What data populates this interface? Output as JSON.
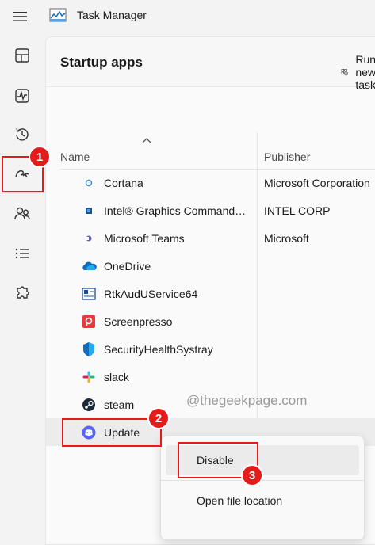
{
  "app": {
    "title": "Task Manager"
  },
  "page": {
    "title": "Startup apps",
    "run_label": "Run new task"
  },
  "columns": {
    "name": "Name",
    "publisher": "Publisher"
  },
  "rows": [
    {
      "name": "Cortana",
      "publisher": "Microsoft Corporation",
      "icon": "cortana-icon"
    },
    {
      "name": "Intel® Graphics Command…",
      "publisher": "INTEL CORP",
      "icon": "intel-graphics-icon"
    },
    {
      "name": "Microsoft Teams",
      "publisher": "Microsoft",
      "icon": "teams-icon"
    },
    {
      "name": "OneDrive",
      "publisher": "",
      "icon": "onedrive-icon"
    },
    {
      "name": "RtkAudUService64",
      "publisher": "",
      "icon": "realtek-icon"
    },
    {
      "name": "Screenpresso",
      "publisher": "",
      "icon": "screenpresso-icon"
    },
    {
      "name": "SecurityHealthSystray",
      "publisher": "",
      "icon": "security-shield-icon"
    },
    {
      "name": "slack",
      "publisher": "",
      "icon": "slack-icon"
    },
    {
      "name": "steam",
      "publisher": "",
      "icon": "steam-icon"
    },
    {
      "name": "Update",
      "publisher": "",
      "icon": "discord-icon"
    }
  ],
  "context_menu": {
    "disable": "Disable",
    "open_location": "Open file location"
  },
  "watermark": "@thegeekpage.com",
  "callouts": [
    "1",
    "2",
    "3"
  ],
  "colors": {
    "callout": "#e51a1a",
    "discord": "#5865f2",
    "onedrive": "#0f6cbd",
    "screenpresso": "#e83c3c"
  }
}
